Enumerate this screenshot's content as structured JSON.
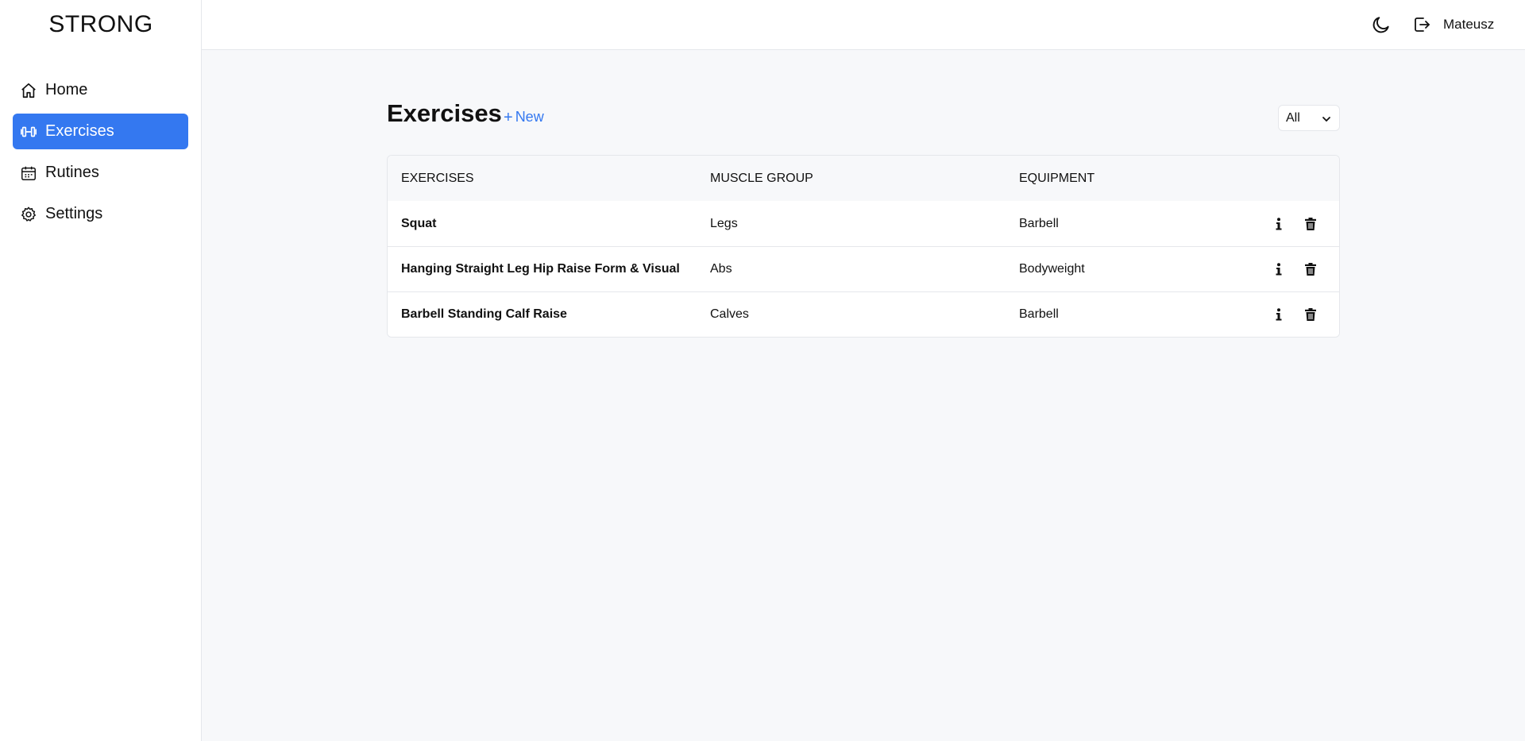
{
  "app": {
    "brand": "STRONG"
  },
  "sidebar": {
    "items": [
      {
        "label": "Home",
        "icon": "home-icon",
        "active": false
      },
      {
        "label": "Exercises",
        "icon": "dumbbell-icon",
        "active": true
      },
      {
        "label": "Rutines",
        "icon": "calendar-icon",
        "active": false
      },
      {
        "label": "Settings",
        "icon": "gear-icon",
        "active": false
      }
    ]
  },
  "topbar": {
    "user_name": "Mateusz",
    "theme_icon": "moon-icon",
    "logout_icon": "logout-icon"
  },
  "main": {
    "title": "Exercises",
    "new_label": "New",
    "filter": {
      "selected": "All"
    },
    "table": {
      "headers": [
        "EXERCISES",
        "MUSCLE GROUP",
        "EQUIPMENT"
      ],
      "rows": [
        {
          "name": "Squat",
          "muscle_group": "Legs",
          "equipment": "Barbell"
        },
        {
          "name": "Hanging Straight Leg Hip Raise Form & Visual",
          "muscle_group": "Abs",
          "equipment": "Bodyweight"
        },
        {
          "name": "Barbell Standing Calf Raise",
          "muscle_group": "Calves",
          "equipment": "Barbell"
        }
      ]
    }
  },
  "colors": {
    "accent": "#3478f0",
    "background": "#f7f8fa",
    "border": "#e5e7eb"
  }
}
